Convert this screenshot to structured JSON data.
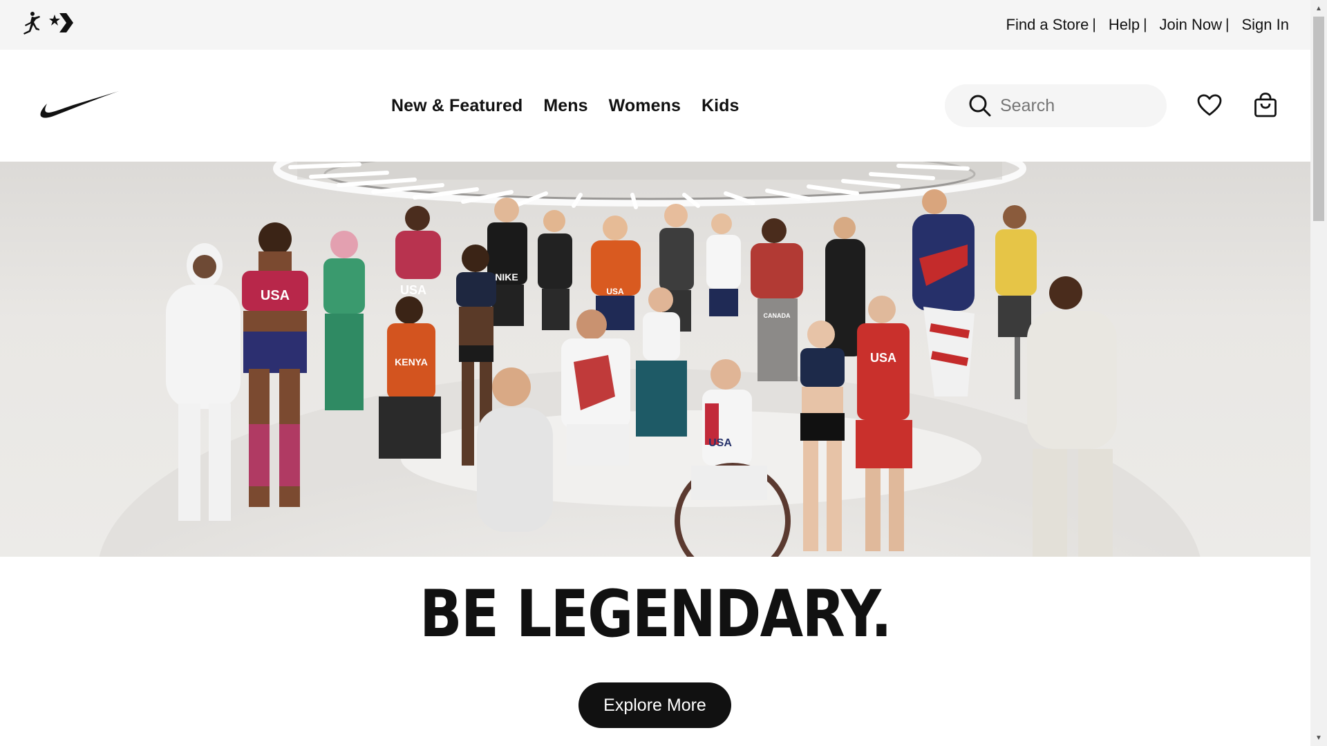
{
  "utility_bar": {
    "brand_icons": [
      "jordan-jumpman-icon",
      "converse-star-chevron-icon"
    ],
    "links": [
      {
        "label": "Find a Store"
      },
      {
        "label": "Help"
      },
      {
        "label": "Join Now"
      },
      {
        "label": "Sign In"
      }
    ],
    "separator": "|"
  },
  "main_nav": {
    "logo_icon": "nike-swoosh-icon",
    "menu": [
      {
        "label": "New & Featured"
      },
      {
        "label": "Mens"
      },
      {
        "label": "Womens"
      },
      {
        "label": "Kids"
      }
    ],
    "search": {
      "placeholder": "Search",
      "value": "",
      "icon": "search-icon"
    },
    "favorites_icon": "heart-icon",
    "bag_icon": "shopping-bag-icon"
  },
  "hero": {
    "image_icon": "athletes-group-photo",
    "jersey_texts": [
      "USA",
      "USA",
      "KENYA",
      "NIKE",
      "USA",
      "CANADA",
      "USA",
      "USA"
    ]
  },
  "headline": "BE LEGENDARY.",
  "cta": {
    "label": "Explore More"
  },
  "colors": {
    "brand_black": "#111111",
    "utility_bg": "#f5f5f5",
    "search_bg": "#f5f5f5",
    "usa_red": "#bf2b2b",
    "usa_navy": "#27336b",
    "kenya_orange": "#d3541f"
  }
}
